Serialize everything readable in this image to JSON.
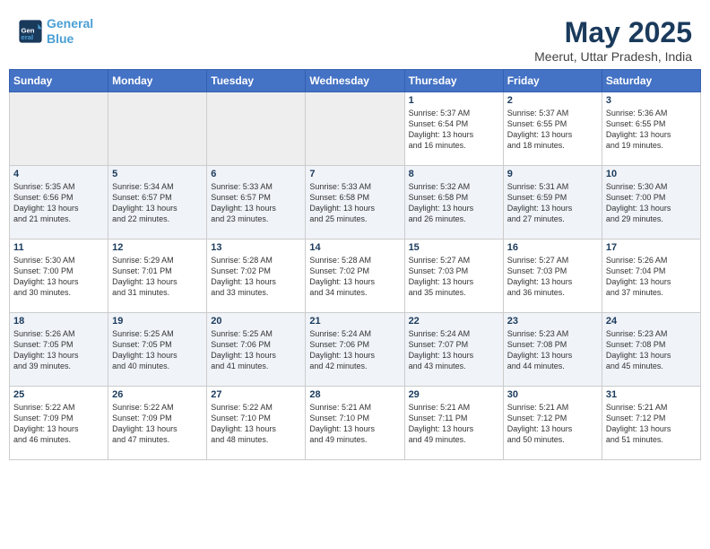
{
  "header": {
    "logo_line1": "General",
    "logo_line2": "Blue",
    "title": "May 2025",
    "subtitle": "Meerut, Uttar Pradesh, India"
  },
  "weekdays": [
    "Sunday",
    "Monday",
    "Tuesday",
    "Wednesday",
    "Thursday",
    "Friday",
    "Saturday"
  ],
  "weeks": [
    [
      {
        "day": "",
        "info": ""
      },
      {
        "day": "",
        "info": ""
      },
      {
        "day": "",
        "info": ""
      },
      {
        "day": "",
        "info": ""
      },
      {
        "day": "1",
        "info": "Sunrise: 5:37 AM\nSunset: 6:54 PM\nDaylight: 13 hours\nand 16 minutes."
      },
      {
        "day": "2",
        "info": "Sunrise: 5:37 AM\nSunset: 6:55 PM\nDaylight: 13 hours\nand 18 minutes."
      },
      {
        "day": "3",
        "info": "Sunrise: 5:36 AM\nSunset: 6:55 PM\nDaylight: 13 hours\nand 19 minutes."
      }
    ],
    [
      {
        "day": "4",
        "info": "Sunrise: 5:35 AM\nSunset: 6:56 PM\nDaylight: 13 hours\nand 21 minutes."
      },
      {
        "day": "5",
        "info": "Sunrise: 5:34 AM\nSunset: 6:57 PM\nDaylight: 13 hours\nand 22 minutes."
      },
      {
        "day": "6",
        "info": "Sunrise: 5:33 AM\nSunset: 6:57 PM\nDaylight: 13 hours\nand 23 minutes."
      },
      {
        "day": "7",
        "info": "Sunrise: 5:33 AM\nSunset: 6:58 PM\nDaylight: 13 hours\nand 25 minutes."
      },
      {
        "day": "8",
        "info": "Sunrise: 5:32 AM\nSunset: 6:58 PM\nDaylight: 13 hours\nand 26 minutes."
      },
      {
        "day": "9",
        "info": "Sunrise: 5:31 AM\nSunset: 6:59 PM\nDaylight: 13 hours\nand 27 minutes."
      },
      {
        "day": "10",
        "info": "Sunrise: 5:30 AM\nSunset: 7:00 PM\nDaylight: 13 hours\nand 29 minutes."
      }
    ],
    [
      {
        "day": "11",
        "info": "Sunrise: 5:30 AM\nSunset: 7:00 PM\nDaylight: 13 hours\nand 30 minutes."
      },
      {
        "day": "12",
        "info": "Sunrise: 5:29 AM\nSunset: 7:01 PM\nDaylight: 13 hours\nand 31 minutes."
      },
      {
        "day": "13",
        "info": "Sunrise: 5:28 AM\nSunset: 7:02 PM\nDaylight: 13 hours\nand 33 minutes."
      },
      {
        "day": "14",
        "info": "Sunrise: 5:28 AM\nSunset: 7:02 PM\nDaylight: 13 hours\nand 34 minutes."
      },
      {
        "day": "15",
        "info": "Sunrise: 5:27 AM\nSunset: 7:03 PM\nDaylight: 13 hours\nand 35 minutes."
      },
      {
        "day": "16",
        "info": "Sunrise: 5:27 AM\nSunset: 7:03 PM\nDaylight: 13 hours\nand 36 minutes."
      },
      {
        "day": "17",
        "info": "Sunrise: 5:26 AM\nSunset: 7:04 PM\nDaylight: 13 hours\nand 37 minutes."
      }
    ],
    [
      {
        "day": "18",
        "info": "Sunrise: 5:26 AM\nSunset: 7:05 PM\nDaylight: 13 hours\nand 39 minutes."
      },
      {
        "day": "19",
        "info": "Sunrise: 5:25 AM\nSunset: 7:05 PM\nDaylight: 13 hours\nand 40 minutes."
      },
      {
        "day": "20",
        "info": "Sunrise: 5:25 AM\nSunset: 7:06 PM\nDaylight: 13 hours\nand 41 minutes."
      },
      {
        "day": "21",
        "info": "Sunrise: 5:24 AM\nSunset: 7:06 PM\nDaylight: 13 hours\nand 42 minutes."
      },
      {
        "day": "22",
        "info": "Sunrise: 5:24 AM\nSunset: 7:07 PM\nDaylight: 13 hours\nand 43 minutes."
      },
      {
        "day": "23",
        "info": "Sunrise: 5:23 AM\nSunset: 7:08 PM\nDaylight: 13 hours\nand 44 minutes."
      },
      {
        "day": "24",
        "info": "Sunrise: 5:23 AM\nSunset: 7:08 PM\nDaylight: 13 hours\nand 45 minutes."
      }
    ],
    [
      {
        "day": "25",
        "info": "Sunrise: 5:22 AM\nSunset: 7:09 PM\nDaylight: 13 hours\nand 46 minutes."
      },
      {
        "day": "26",
        "info": "Sunrise: 5:22 AM\nSunset: 7:09 PM\nDaylight: 13 hours\nand 47 minutes."
      },
      {
        "day": "27",
        "info": "Sunrise: 5:22 AM\nSunset: 7:10 PM\nDaylight: 13 hours\nand 48 minutes."
      },
      {
        "day": "28",
        "info": "Sunrise: 5:21 AM\nSunset: 7:10 PM\nDaylight: 13 hours\nand 49 minutes."
      },
      {
        "day": "29",
        "info": "Sunrise: 5:21 AM\nSunset: 7:11 PM\nDaylight: 13 hours\nand 49 minutes."
      },
      {
        "day": "30",
        "info": "Sunrise: 5:21 AM\nSunset: 7:12 PM\nDaylight: 13 hours\nand 50 minutes."
      },
      {
        "day": "31",
        "info": "Sunrise: 5:21 AM\nSunset: 7:12 PM\nDaylight: 13 hours\nand 51 minutes."
      }
    ]
  ]
}
